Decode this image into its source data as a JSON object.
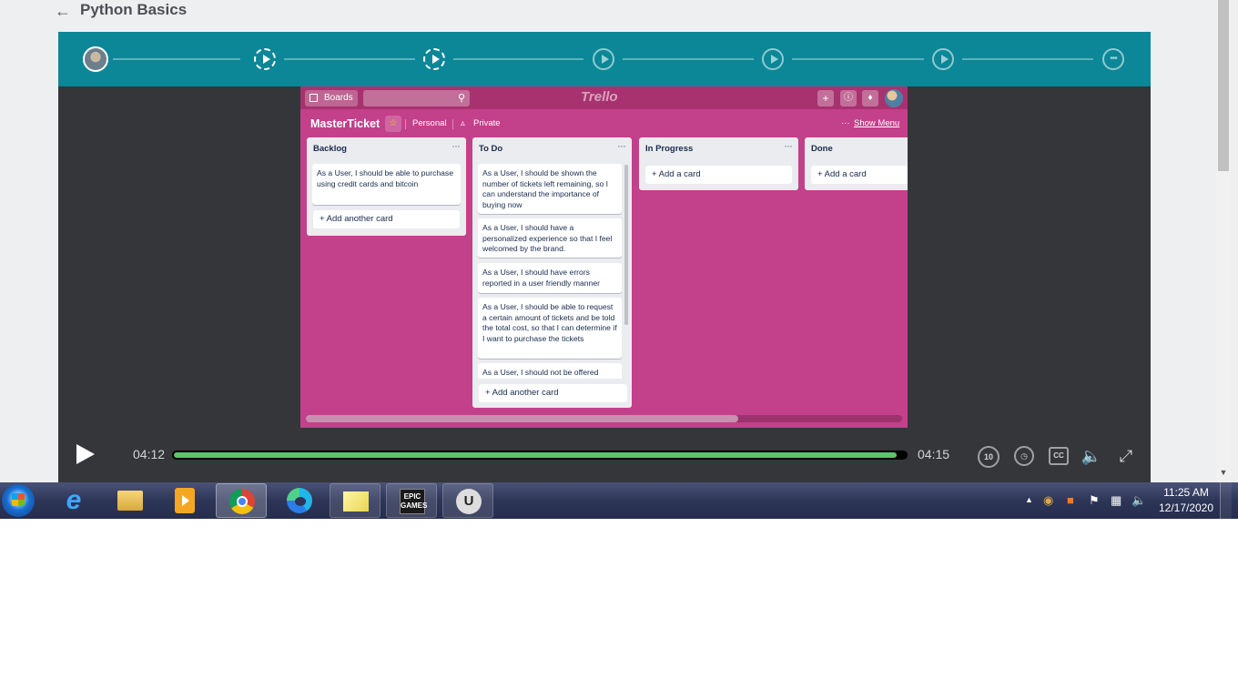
{
  "page": {
    "title": "Python Basics"
  },
  "trello": {
    "boards_label": "Boards",
    "logo_text": "Trello",
    "board_name": "MasterTicket",
    "team_label": "Personal",
    "visibility_label": "Private",
    "show_menu_label": "Show Menu",
    "lists": [
      {
        "title": "Backlog",
        "cards": [
          "As a User, I should be able to purchase using credit cards and bitcoin"
        ],
        "add_label": "+ Add another card"
      },
      {
        "title": "To Do",
        "cards": [
          "As a User, I should be shown the number of tickets left remaining, so I can understand the importance of buying now",
          "As a User, I should have a personalized experience so that I feel welcomed by the brand.",
          "As a User, I should have errors reported in a user friendly manner",
          "As a User, I should be able to request a certain amount of tickets and be told the total cost, so that I can determine if I want to purchase the tickets",
          "As a User, I should not be offered"
        ],
        "add_label": "+ Add another card"
      },
      {
        "title": "In Progress",
        "cards": [],
        "add_label": "+ Add a card"
      },
      {
        "title": "Done",
        "cards": [],
        "add_label": "+ Add a card"
      }
    ]
  },
  "player": {
    "current_time": "04:12",
    "total_time": "04:15",
    "progress_fraction": 0.988,
    "rewind_label": "10",
    "cc_label": "CC"
  },
  "taskbar": {
    "clock_time": "11:25 AM",
    "clock_date": "12/17/2020",
    "epic_label": "EPIC\nGAMES",
    "ue_label": "U"
  }
}
